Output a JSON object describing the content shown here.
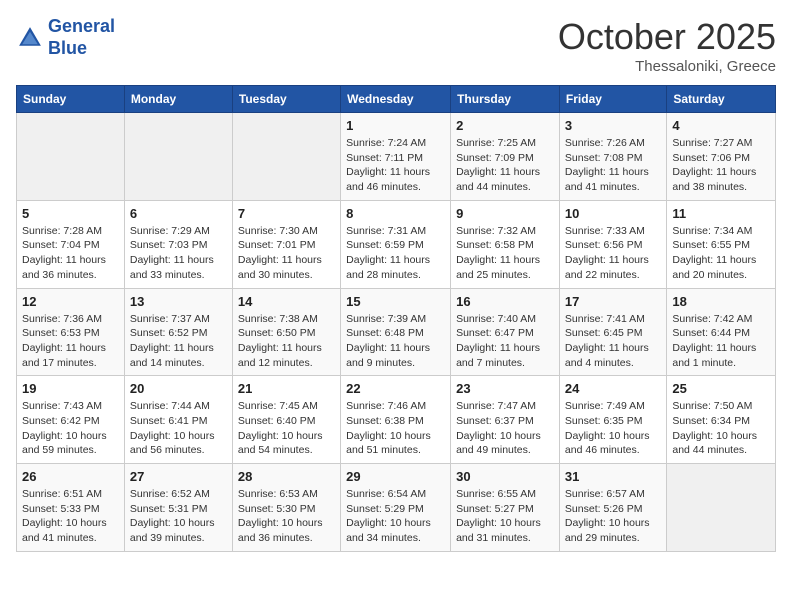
{
  "header": {
    "logo_line1": "General",
    "logo_line2": "Blue",
    "month": "October 2025",
    "location": "Thessaloniki, Greece"
  },
  "weekdays": [
    "Sunday",
    "Monday",
    "Tuesday",
    "Wednesday",
    "Thursday",
    "Friday",
    "Saturday"
  ],
  "weeks": [
    [
      {
        "day": "",
        "info": ""
      },
      {
        "day": "",
        "info": ""
      },
      {
        "day": "",
        "info": ""
      },
      {
        "day": "1",
        "info": "Sunrise: 7:24 AM\nSunset: 7:11 PM\nDaylight: 11 hours and 46 minutes."
      },
      {
        "day": "2",
        "info": "Sunrise: 7:25 AM\nSunset: 7:09 PM\nDaylight: 11 hours and 44 minutes."
      },
      {
        "day": "3",
        "info": "Sunrise: 7:26 AM\nSunset: 7:08 PM\nDaylight: 11 hours and 41 minutes."
      },
      {
        "day": "4",
        "info": "Sunrise: 7:27 AM\nSunset: 7:06 PM\nDaylight: 11 hours and 38 minutes."
      }
    ],
    [
      {
        "day": "5",
        "info": "Sunrise: 7:28 AM\nSunset: 7:04 PM\nDaylight: 11 hours and 36 minutes."
      },
      {
        "day": "6",
        "info": "Sunrise: 7:29 AM\nSunset: 7:03 PM\nDaylight: 11 hours and 33 minutes."
      },
      {
        "day": "7",
        "info": "Sunrise: 7:30 AM\nSunset: 7:01 PM\nDaylight: 11 hours and 30 minutes."
      },
      {
        "day": "8",
        "info": "Sunrise: 7:31 AM\nSunset: 6:59 PM\nDaylight: 11 hours and 28 minutes."
      },
      {
        "day": "9",
        "info": "Sunrise: 7:32 AM\nSunset: 6:58 PM\nDaylight: 11 hours and 25 minutes."
      },
      {
        "day": "10",
        "info": "Sunrise: 7:33 AM\nSunset: 6:56 PM\nDaylight: 11 hours and 22 minutes."
      },
      {
        "day": "11",
        "info": "Sunrise: 7:34 AM\nSunset: 6:55 PM\nDaylight: 11 hours and 20 minutes."
      }
    ],
    [
      {
        "day": "12",
        "info": "Sunrise: 7:36 AM\nSunset: 6:53 PM\nDaylight: 11 hours and 17 minutes."
      },
      {
        "day": "13",
        "info": "Sunrise: 7:37 AM\nSunset: 6:52 PM\nDaylight: 11 hours and 14 minutes."
      },
      {
        "day": "14",
        "info": "Sunrise: 7:38 AM\nSunset: 6:50 PM\nDaylight: 11 hours and 12 minutes."
      },
      {
        "day": "15",
        "info": "Sunrise: 7:39 AM\nSunset: 6:48 PM\nDaylight: 11 hours and 9 minutes."
      },
      {
        "day": "16",
        "info": "Sunrise: 7:40 AM\nSunset: 6:47 PM\nDaylight: 11 hours and 7 minutes."
      },
      {
        "day": "17",
        "info": "Sunrise: 7:41 AM\nSunset: 6:45 PM\nDaylight: 11 hours and 4 minutes."
      },
      {
        "day": "18",
        "info": "Sunrise: 7:42 AM\nSunset: 6:44 PM\nDaylight: 11 hours and 1 minute."
      }
    ],
    [
      {
        "day": "19",
        "info": "Sunrise: 7:43 AM\nSunset: 6:42 PM\nDaylight: 10 hours and 59 minutes."
      },
      {
        "day": "20",
        "info": "Sunrise: 7:44 AM\nSunset: 6:41 PM\nDaylight: 10 hours and 56 minutes."
      },
      {
        "day": "21",
        "info": "Sunrise: 7:45 AM\nSunset: 6:40 PM\nDaylight: 10 hours and 54 minutes."
      },
      {
        "day": "22",
        "info": "Sunrise: 7:46 AM\nSunset: 6:38 PM\nDaylight: 10 hours and 51 minutes."
      },
      {
        "day": "23",
        "info": "Sunrise: 7:47 AM\nSunset: 6:37 PM\nDaylight: 10 hours and 49 minutes."
      },
      {
        "day": "24",
        "info": "Sunrise: 7:49 AM\nSunset: 6:35 PM\nDaylight: 10 hours and 46 minutes."
      },
      {
        "day": "25",
        "info": "Sunrise: 7:50 AM\nSunset: 6:34 PM\nDaylight: 10 hours and 44 minutes."
      }
    ],
    [
      {
        "day": "26",
        "info": "Sunrise: 6:51 AM\nSunset: 5:33 PM\nDaylight: 10 hours and 41 minutes."
      },
      {
        "day": "27",
        "info": "Sunrise: 6:52 AM\nSunset: 5:31 PM\nDaylight: 10 hours and 39 minutes."
      },
      {
        "day": "28",
        "info": "Sunrise: 6:53 AM\nSunset: 5:30 PM\nDaylight: 10 hours and 36 minutes."
      },
      {
        "day": "29",
        "info": "Sunrise: 6:54 AM\nSunset: 5:29 PM\nDaylight: 10 hours and 34 minutes."
      },
      {
        "day": "30",
        "info": "Sunrise: 6:55 AM\nSunset: 5:27 PM\nDaylight: 10 hours and 31 minutes."
      },
      {
        "day": "31",
        "info": "Sunrise: 6:57 AM\nSunset: 5:26 PM\nDaylight: 10 hours and 29 minutes."
      },
      {
        "day": "",
        "info": ""
      }
    ]
  ]
}
